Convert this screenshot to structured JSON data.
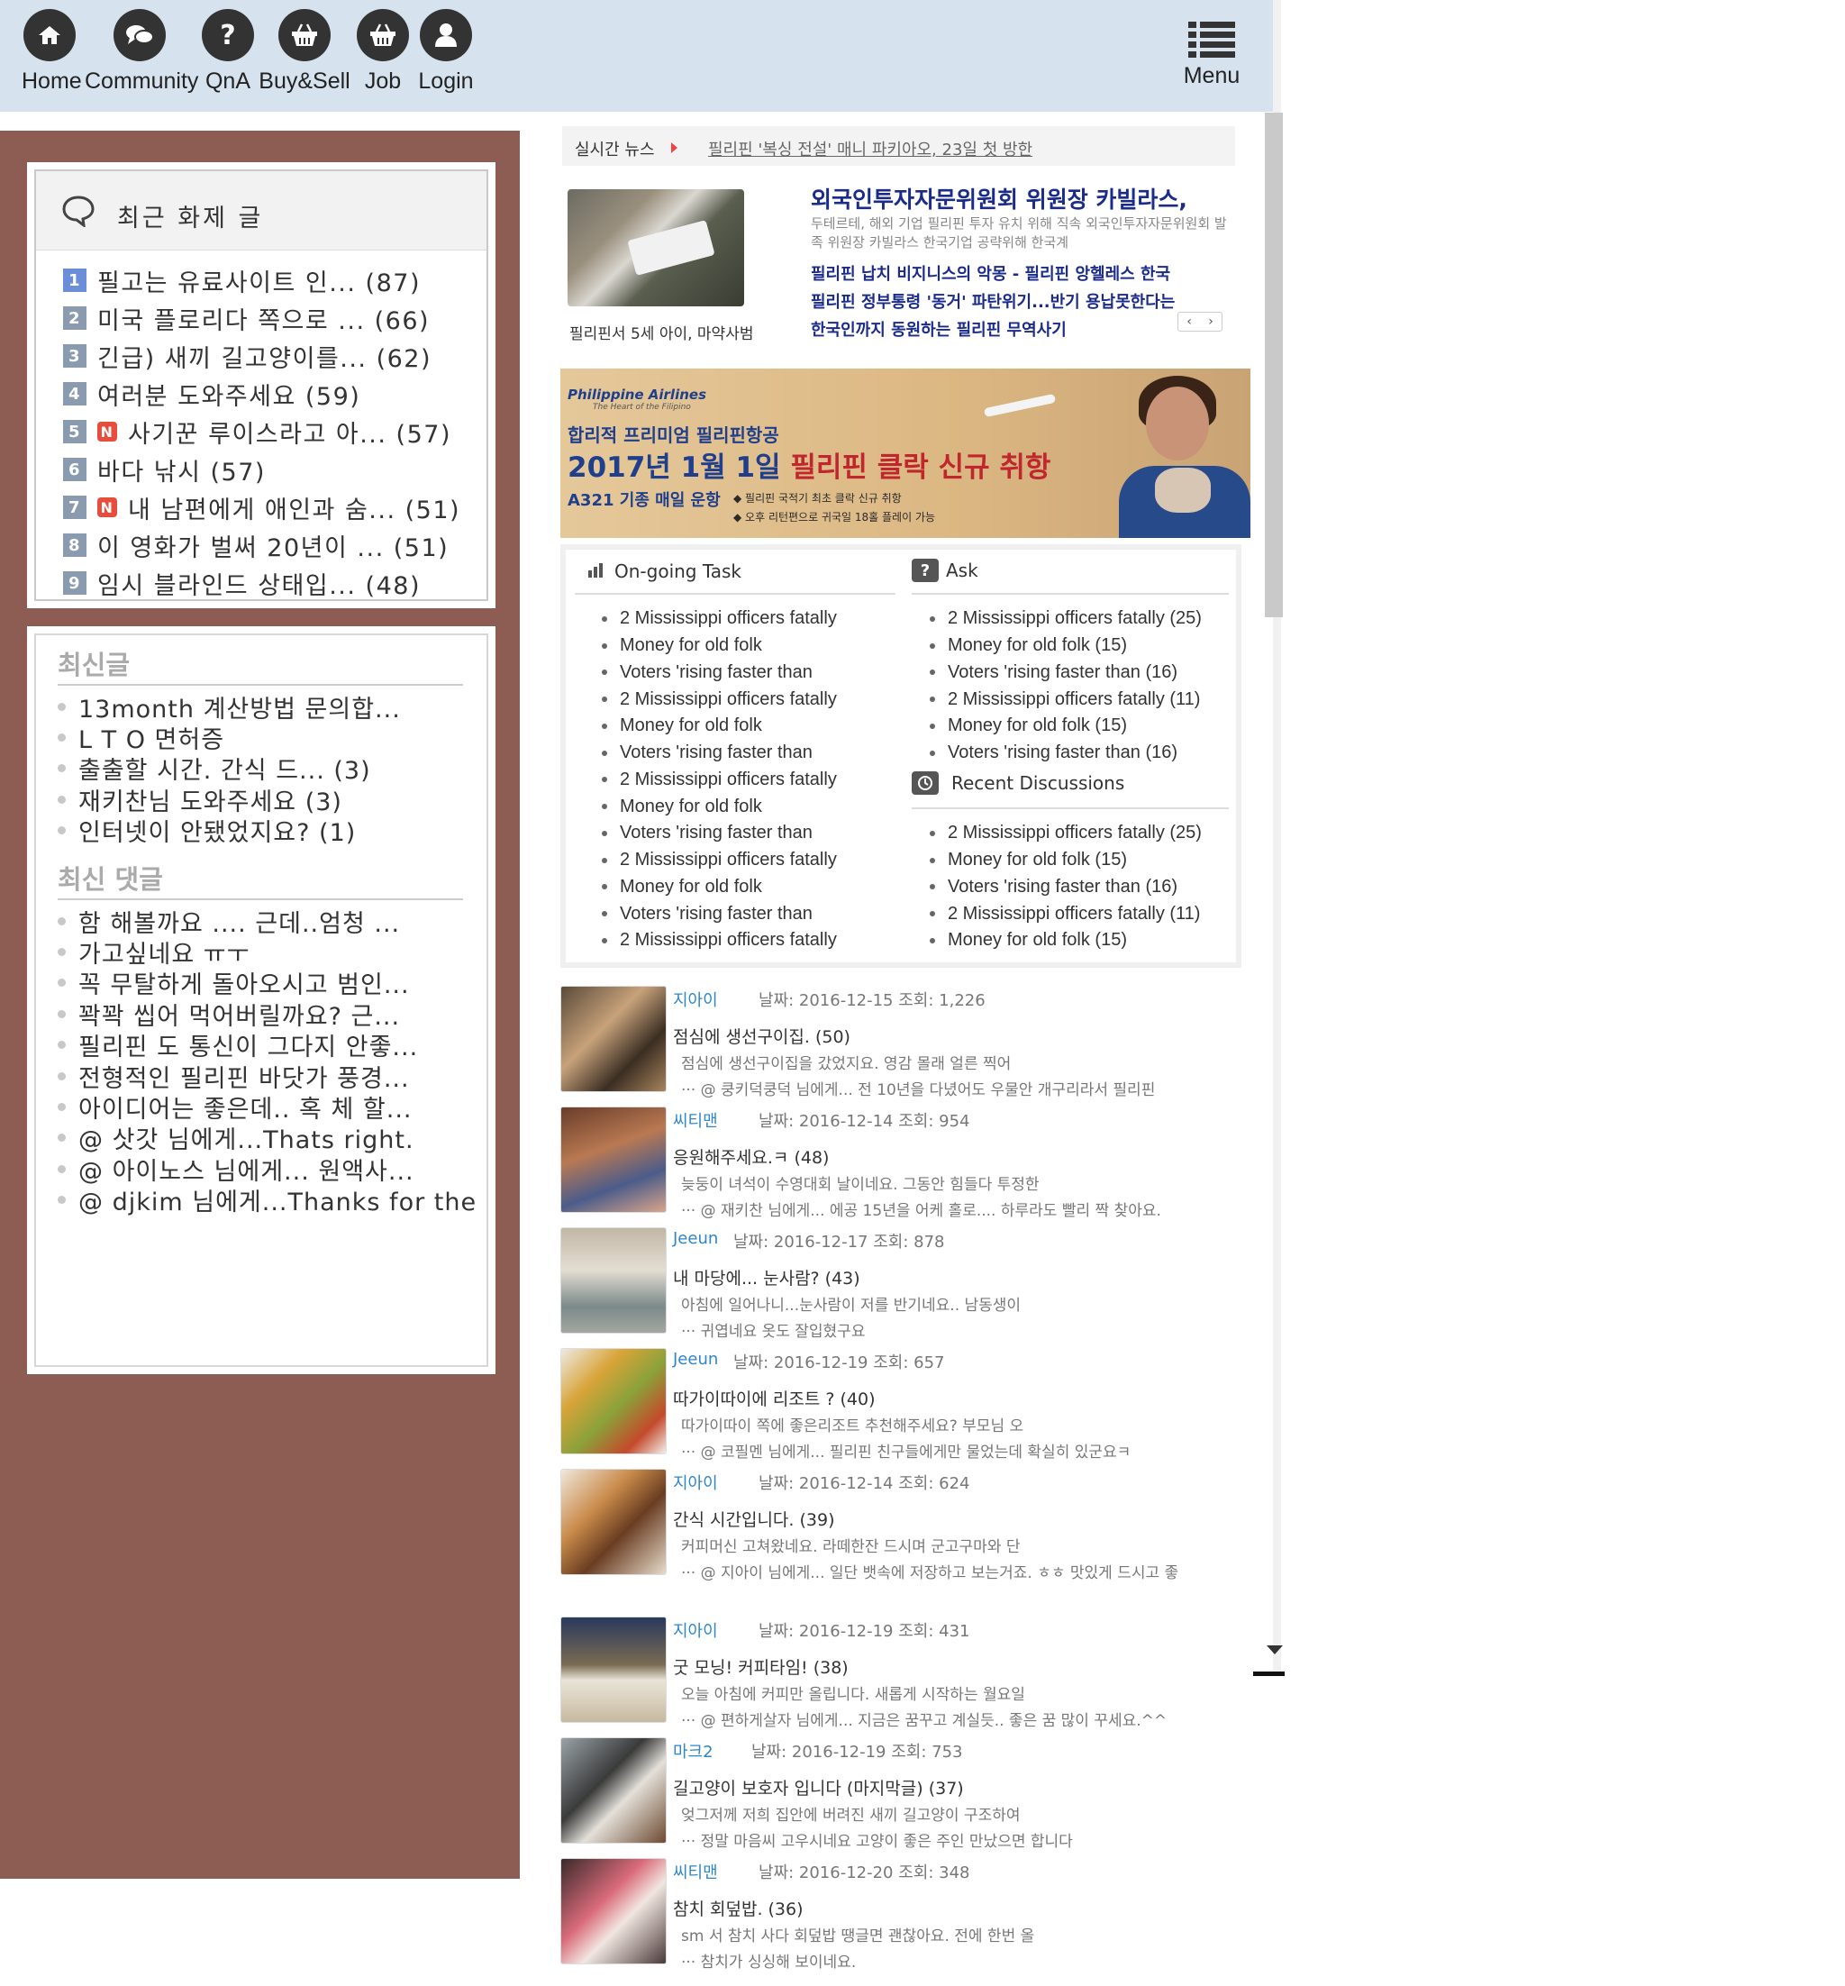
{
  "nav": {
    "items": [
      {
        "label": "Home",
        "icon": "home-icon"
      },
      {
        "label": "Community",
        "icon": "chat-bubbles-icon"
      },
      {
        "label": "QnA",
        "icon": "question-icon"
      },
      {
        "label": "Buy&Sell",
        "icon": "basket-icon"
      },
      {
        "label": "Job",
        "icon": "basket-icon"
      },
      {
        "label": "Login",
        "icon": "user-icon"
      }
    ],
    "menu_label": "Menu",
    "menu_icon": "list-menu-icon"
  },
  "hot_topics": {
    "title": "최근 화제 글",
    "items": [
      {
        "num": "1",
        "text": "필고는 유료사이트 인... (87)",
        "new": false
      },
      {
        "num": "2",
        "text": "미국 플로리다 쪽으로 ... (66)",
        "new": false
      },
      {
        "num": "3",
        "text": "긴급) 새끼 길고양이를... (62)",
        "new": false
      },
      {
        "num": "4",
        "text": "여러분 도와주세요 (59)",
        "new": false
      },
      {
        "num": "5",
        "text": "사기꾼 루이스라고 아... (57)",
        "new": true
      },
      {
        "num": "6",
        "text": "바다 낚시 (57)",
        "new": false
      },
      {
        "num": "7",
        "text": "내 남편에게 애인과 숨... (51)",
        "new": true
      },
      {
        "num": "8",
        "text": "이 영화가 벌써 20년이 ... (51)",
        "new": false
      },
      {
        "num": "9",
        "text": "임시 블라인드 상태입... (48)",
        "new": false
      }
    ],
    "new_badge": "N"
  },
  "latest": {
    "posts_title": "최신글",
    "posts": [
      "13month 계산방법 문의합...",
      "L T O 면허증",
      "출출할 시간. 간식 드... (3)",
      "재키찬님 도와주세요 (3)",
      "인터넷이 안됐었지요? (1)"
    ],
    "comments_title": "최신 댓글",
    "comments": [
      "함 해볼까요 .... 근데..엄청 ...",
      "가고싶네요 ㅠㅜ",
      "꼭 무탈하게 돌아오시고 범인...",
      "꽉꽉 씹어 먹어버릴까요? 근...",
      "필리핀 도 통신이 그다지 안좋...",
      "전형적인 필리핀 바닷가 풍경...",
      "아이디어는 좋은데.. 혹 체 할...",
      "@ 삿갓 님에게...Thats right.",
      "@ 아이노스 님에게... 원액사...",
      "@ djkim 님에게...Thanks for the"
    ]
  },
  "news": {
    "ticker_label": "실시간 뉴스",
    "ticker_text": "필리핀 '복싱 전설' 매니 파키아오, 23일 첫 방한",
    "photo_caption": "필리핀서 5세 아이, 마약사범",
    "headline": "외국인투자자문위원회 위원장 카빌라스,",
    "summary": "두테르테, 해외 기업 필리핀 투자 유치 위해 직속 외국인투자자문위원회 발족 위원장 카빌라스 한국기업 공략위해 한국계",
    "links": [
      "필리핀 납치 비지니스의 악몽 - 필리핀 앙헬레스 한국",
      "필리핀 정부통령 '동거' 파탄위기...반기 용납못한다는",
      "한국인까지 동원하는 필리핀 무역사기"
    ],
    "prev": "‹",
    "next": "›"
  },
  "ad": {
    "brand": "Philippine Airlines",
    "brand_sub": "The Heart of the Filipino",
    "tagline": "합리적 프리미엄 필리핀항공",
    "headline_blue": "2017년 1월 1일 ",
    "headline_red": "필리핀 클락 신규 취항",
    "route": "A321 기종 매일 운항",
    "bullets": [
      "◆ 필리핀 국적기 최초 클락 신규 취항",
      "◆ 오후 리턴편으로 귀국일 18홀 플레이 가능"
    ]
  },
  "tasks": {
    "ongoing_title": "On-going Task",
    "ongoing": [
      "2 Mississippi officers fatally",
      "Money for old folk",
      "Voters 'rising faster than",
      "2 Mississippi officers fatally",
      "Money for old folk",
      "Voters 'rising faster than",
      "2 Mississippi officers fatally",
      "Money for old folk",
      "Voters 'rising faster than",
      "2 Mississippi officers fatally",
      "Money for old folk",
      "Voters 'rising faster than",
      "2 Mississippi officers fatally"
    ],
    "ask_title": "Ask",
    "ask": [
      "2 Mississippi officers fatally (25)",
      "Money for old folk (15)",
      "Voters 'rising faster than (16)",
      "2 Mississippi officers fatally (11)",
      "Money for old folk (15)",
      "Voters 'rising faster than (16)"
    ],
    "recent_title": "Recent Discussions",
    "recent": [
      "2 Mississippi officers fatally (25)",
      "Money for old folk (15)",
      "Voters 'rising faster than (16)",
      "2 Mississippi officers fatally (11)",
      "Money for old folk (15)"
    ]
  },
  "feed": [
    {
      "author": "지아이",
      "meta": "날짜: 2016-12-15 조회: 1,226",
      "title": "점심에 생선구이집. (50)",
      "excerpt": "점심에 생선구이집을 갔었지요. 영감 몰래 얼른 찍어",
      "comment": "··· @ 쿵키덕쿵덕 님에게... 전 10년을 다녔어도 우물안 개구리라서 필리핀"
    },
    {
      "author": "씨티맨",
      "meta": "날짜: 2016-12-14 조회: 954",
      "title": "응원해주세요.ㅋ (48)",
      "excerpt": "늦둥이 녀석이 수영대회 날이네요. 그동안 힘들다 투정한",
      "comment": "··· @ 재키찬 님에게... 에공 15년을 어케 홀로.... 하루라도 빨리 짝 찾아요."
    },
    {
      "author": "Jeeun",
      "meta": "날짜: 2016-12-17 조회: 878",
      "title": "내 마당에... 눈사람? (43)",
      "excerpt": "아침에 일어나니...눈사람이 저를 반기네요.. 남동생이",
      "comment": "··· 귀엽네요 옷도 잘입혔구요"
    },
    {
      "author": "Jeeun",
      "meta": "날짜: 2016-12-19 조회: 657",
      "title": "따가이따이에 리조트 ? (40)",
      "excerpt": "따가이따이 쪽에 좋은리조트 추천해주세요? 부모님 오",
      "comment": "··· @ 코필멘 님에게... 필리핀 친구들에게만 물었는데 확실히 있군요ㅋ"
    },
    {
      "author": "지아이",
      "meta": "날짜: 2016-12-14 조회: 624",
      "title": "간식 시간입니다. (39)",
      "excerpt": "커피머신 고쳐왔네요. 라떼한잔 드시며 군고구마와 단",
      "comment": "··· @ 지아이 님에게... 일단 뱃속에 저장하고 보는거죠. ㅎㅎ 맛있게 드시고 좋"
    },
    {
      "author": "지아이",
      "meta": "날짜: 2016-12-19 조회: 431",
      "title": "굿 모닝! 커피타임! (38)",
      "excerpt": "오늘 아침에 커피만 올립니다. 새롭게 시작하는 월요일",
      "comment": "··· @ 편하게살자 님에게... 지금은 꿈꾸고 계실듯.. 좋은 꿈 많이 꾸세요.^^"
    },
    {
      "author": "마크2",
      "meta": "날짜: 2016-12-19 조회: 753",
      "title": "길고양이 보호자 입니다 (마지막글) (37)",
      "excerpt": "엊그저께 저희 집안에 버려진 새끼 길고양이 구조하여",
      "comment": "··· 정말 마음씨 고우시네요 고양이 좋은 주인 만났으면 합니다"
    },
    {
      "author": "씨티맨",
      "meta": "날짜: 2016-12-20 조회: 348",
      "title": "참치 회덮밥. (36)",
      "excerpt": "sm 서 참치 사다 회덮밥 땡글면 괜찮아요. 전에 한번 올",
      "comment": "··· 참치가 싱싱해 보이네요."
    }
  ],
  "colors": {
    "nav_bg": "#d6e3ef",
    "left_bg": "#8d5c52",
    "headline_blue": "#1a2b8a",
    "author_blue": "#2f86c9",
    "badge_red": "#e84c3d"
  }
}
